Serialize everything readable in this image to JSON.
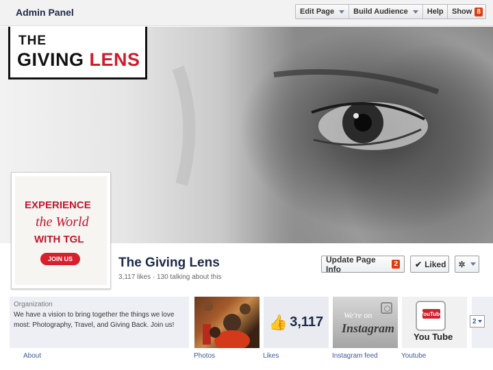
{
  "admin_bar": {
    "title": "Admin Panel",
    "buttons": [
      {
        "label": "Edit Page"
      },
      {
        "label": "Build Audience"
      },
      {
        "label": "Help"
      }
    ],
    "show": {
      "label": "Show",
      "badge": "8"
    }
  },
  "cover": {
    "logo": {
      "line1": "THE",
      "word1": "GIVING",
      "word2": "LENS"
    }
  },
  "profile_picture": {
    "line1": "EXPERIENCE",
    "line2": "the World",
    "line3": "WITH TGL",
    "button": "JOIN US"
  },
  "page": {
    "name": "The Giving Lens",
    "stats": "3,117 likes · 130 talking about this"
  },
  "actions": {
    "update_info": {
      "label": "Update Page Info",
      "badge": "2"
    },
    "liked": {
      "label": "Liked"
    }
  },
  "about": {
    "category": "Organization",
    "text": "We have a vision to bring together the things we love most: Photography, Travel, and Giving Back. Join us!",
    "label": "About"
  },
  "tiles": {
    "photos_label": "Photos",
    "likes_label": "Likes",
    "likes_count": "3,117",
    "instagram_label": "Instagram feed",
    "instagram_were": "We're on",
    "instagram_word": "Instagram",
    "youtube_label": "Youtube",
    "youtube_you": "You",
    "youtube_tube": "Tube",
    "youtube_word": "You Tube",
    "more_count": "2"
  },
  "colors": {
    "admin_bg": "#f2f2f2",
    "link": "#3b5998",
    "badge": "#dd3c10",
    "brand_red": "#d01b2b"
  }
}
